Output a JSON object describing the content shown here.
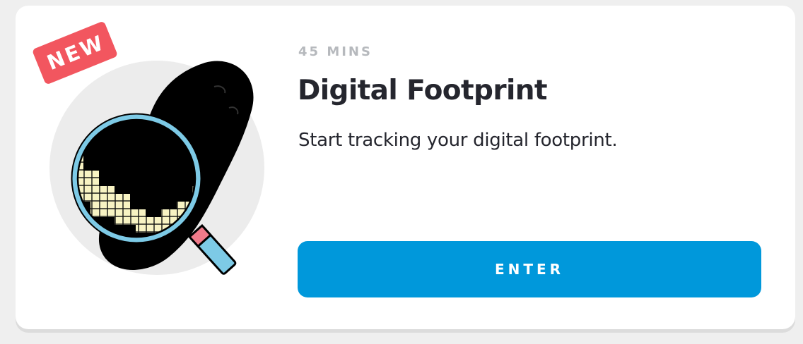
{
  "card": {
    "badge_label": "NEW",
    "duration": "45 MINS",
    "title": "Digital Footprint",
    "description": "Start tracking your digital footprint.",
    "button_label": "ENTER"
  },
  "illustration": {
    "icon": "footprint-magnifying-glass-icon"
  },
  "colors": {
    "accent": "#0098db",
    "badge": "#f2565f",
    "title_text": "#25262e",
    "muted_text": "#b6b9bd",
    "lens_frame": "#7dcae6",
    "lens_pixels": "#f8f3c3"
  }
}
